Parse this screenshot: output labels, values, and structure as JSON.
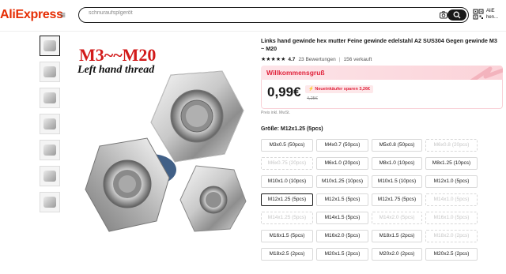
{
  "header": {
    "logo": "AliExpress",
    "menu_icon": "menu-icon",
    "search_placeholder": "schnuraufsplgeröt",
    "app_line1": "AliE",
    "app_line2": "hen..."
  },
  "gallery": {
    "thumb_count": 7,
    "active_index": 0,
    "main_title": "M3~~M20",
    "main_subtitle": "Left hand thread"
  },
  "product": {
    "title": "Links hand gewinde hex mutter Feine gewinde edelstahl A2 SUS304 Gegen gewinde M3 ~ M20",
    "rating_value": "4.7",
    "stars": "★★★★★",
    "reviews": "23 Bewertungen",
    "sold": "156 verkauft"
  },
  "promo": {
    "title": "Willkommensgruß",
    "price": "0,99€",
    "newbuyer": "Neueinkäufer sparen 3,26€",
    "old_price": "4,25€",
    "vat_note": "Preis inkl. MwSt.",
    "accent_color": "#e0223b"
  },
  "size": {
    "label": "Größe: M12x1.25 (5pcs)",
    "options": [
      {
        "label": "M3x0.5 (50pcs)",
        "state": "normal"
      },
      {
        "label": "M4x0.7 (50pcs)",
        "state": "normal"
      },
      {
        "label": "M5x0.8 (50pcs)",
        "state": "normal"
      },
      {
        "label": "M6x0.8 (20pcs)",
        "state": "disabled"
      },
      {
        "label": "M6x0.75 (20pcs)",
        "state": "disabled"
      },
      {
        "label": "M6x1.0 (20pcs)",
        "state": "normal"
      },
      {
        "label": "M8x1.0 (10pcs)",
        "state": "normal"
      },
      {
        "label": "M8x1.25 (10pcs)",
        "state": "normal"
      },
      {
        "label": "M10x1.0 (10pcs)",
        "state": "normal"
      },
      {
        "label": "M10x1.25 (10pcs)",
        "state": "normal"
      },
      {
        "label": "M10x1.5 (10pcs)",
        "state": "normal"
      },
      {
        "label": "M12x1.0 (5pcs)",
        "state": "normal"
      },
      {
        "label": "M12x1.25 (5pcs)",
        "state": "selected"
      },
      {
        "label": "M12x1.5 (5pcs)",
        "state": "normal"
      },
      {
        "label": "M12x1.75 (5pcs)",
        "state": "normal"
      },
      {
        "label": "M14x1.0 (5pcs)",
        "state": "disabled"
      },
      {
        "label": "M14x1.25 (5pcs)",
        "state": "disabled"
      },
      {
        "label": "M14x1.5 (5pcs)",
        "state": "normal"
      },
      {
        "label": "M14x2.0 (5pcs)",
        "state": "disabled"
      },
      {
        "label": "M16x1.0 (5pcs)",
        "state": "disabled"
      },
      {
        "label": "M16x1.5 (5pcs)",
        "state": "normal"
      },
      {
        "label": "M16x2.0 (5pcs)",
        "state": "normal"
      },
      {
        "label": "M18x1.5 (2pcs)",
        "state": "normal"
      },
      {
        "label": "M18x2.0 (2pcs)",
        "state": "disabled"
      },
      {
        "label": "M18x2.5 (2pcs)",
        "state": "normal"
      },
      {
        "label": "M20x1.5 (2pcs)",
        "state": "normal"
      },
      {
        "label": "M20x2.0 (2pcs)",
        "state": "normal"
      },
      {
        "label": "M20x2.5 (2pcs)",
        "state": "normal"
      }
    ]
  }
}
